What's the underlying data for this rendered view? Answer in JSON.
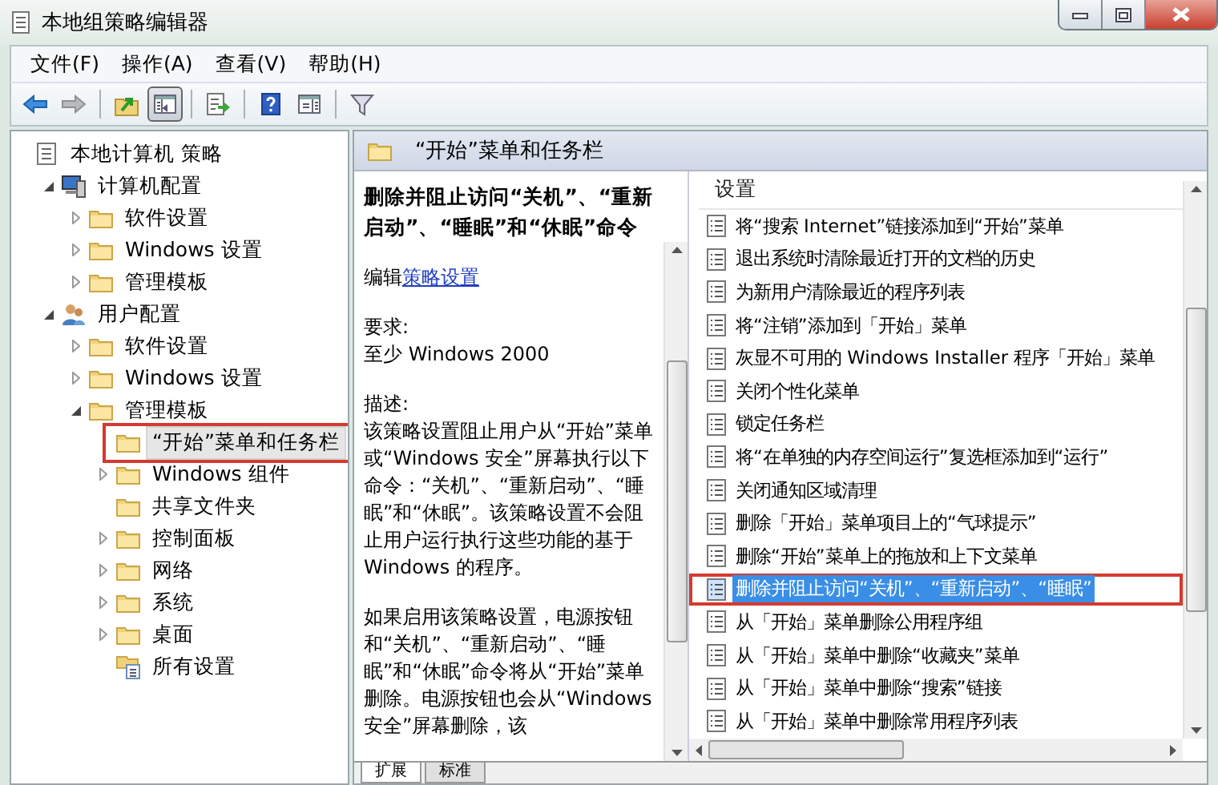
{
  "window": {
    "title": "本地组策略编辑器"
  },
  "menu": [
    {
      "label": "文件(F)"
    },
    {
      "label": "操作(A)"
    },
    {
      "label": "查看(V)"
    },
    {
      "label": "帮助(H)"
    }
  ],
  "toolbar": [
    {
      "kind": "back",
      "disabled": false,
      "pressed": false
    },
    {
      "kind": "forward",
      "disabled": true,
      "pressed": false
    },
    {
      "kind": "separator"
    },
    {
      "kind": "up",
      "disabled": false,
      "pressed": false
    },
    {
      "kind": "tree",
      "disabled": false,
      "pressed": true
    },
    {
      "kind": "separator"
    },
    {
      "kind": "export",
      "disabled": false,
      "pressed": false
    },
    {
      "kind": "separator"
    },
    {
      "kind": "help",
      "disabled": false,
      "pressed": false
    },
    {
      "kind": "pane",
      "disabled": false,
      "pressed": false
    },
    {
      "kind": "separator"
    },
    {
      "kind": "filter",
      "disabled": false,
      "pressed": false
    }
  ],
  "tree": [
    {
      "label": "本地计算机 策略",
      "kind": "policy",
      "selected": false,
      "annotated": false,
      "children": [
        {
          "label": "计算机配置",
          "kind": "computer",
          "expanded": true,
          "selected": false,
          "annotated": false,
          "children": [
            {
              "label": "软件设置",
              "kind": "folder",
              "expanded": false,
              "selected": false,
              "annotated": false
            },
            {
              "label": "Windows 设置",
              "kind": "folder",
              "expanded": false,
              "selected": false,
              "annotated": false
            },
            {
              "label": "管理模板",
              "kind": "folder",
              "expanded": false,
              "selected": false,
              "annotated": false
            }
          ]
        },
        {
          "label": "用户配置",
          "kind": "user",
          "expanded": true,
          "selected": false,
          "annotated": false,
          "children": [
            {
              "label": "软件设置",
              "kind": "folder",
              "expanded": false,
              "selected": false,
              "annotated": false
            },
            {
              "label": "Windows 设置",
              "kind": "folder",
              "expanded": false,
              "selected": false,
              "annotated": false
            },
            {
              "label": "管理模板",
              "kind": "folder",
              "expanded": true,
              "selected": false,
              "annotated": false,
              "children": [
                {
                  "label": "“开始”菜单和任务栏",
                  "kind": "folder",
                  "selected": true,
                  "annotated": true
                },
                {
                  "label": "Windows 组件",
                  "kind": "folder",
                  "expanded": false,
                  "selected": false,
                  "annotated": false
                },
                {
                  "label": "共享文件夹",
                  "kind": "folder",
                  "selected": false,
                  "annotated": false
                },
                {
                  "label": "控制面板",
                  "kind": "folder",
                  "expanded": false,
                  "selected": false,
                  "annotated": false
                },
                {
                  "label": "网络",
                  "kind": "folder",
                  "expanded": false,
                  "selected": false,
                  "annotated": false
                },
                {
                  "label": "系统",
                  "kind": "folder",
                  "expanded": false,
                  "selected": false,
                  "annotated": false
                },
                {
                  "label": "桌面",
                  "kind": "folder",
                  "expanded": false,
                  "selected": false,
                  "annotated": false
                },
                {
                  "label": "所有设置",
                  "kind": "all-settings",
                  "selected": false,
                  "annotated": false
                }
              ]
            }
          ]
        }
      ]
    }
  ],
  "pane": {
    "title": "“开始”菜单和任务栏"
  },
  "description": {
    "title": "删除并阻止访问“关机”、“重新启动”、“睡眠”和“休眠”命令",
    "edit_prefix": "编辑",
    "edit_link": "策略设置",
    "requirements_label": "要求:",
    "requirements": "至少 Windows 2000",
    "description_label": "描述:",
    "paragraphs": [
      "该策略设置阻止用户从“开始”菜单或“Windows 安全”屏幕执行以下命令：“关机”、“重新启动”、“睡眠”和“休眠”。该策略设置不会阻止用户运行执行这些功能的基于 Windows 的程序。",
      "如果启用该策略设置，电源按钮和“关机”、“重新启动”、“睡眠”和“休眠”命令将从“开始”菜单删除。电源按钮也会从“Windows 安全”屏幕删除，该"
    ]
  },
  "list": {
    "column": "设置",
    "rows": [
      {
        "label": "将“搜索 Internet”链接添加到“开始”菜单",
        "selected": false,
        "annotated": false
      },
      {
        "label": "退出系统时清除最近打开的文档的历史",
        "selected": false,
        "annotated": false
      },
      {
        "label": "为新用户清除最近的程序列表",
        "selected": false,
        "annotated": false
      },
      {
        "label": "将“注销”添加到「开始」菜单",
        "selected": false,
        "annotated": false
      },
      {
        "label": "灰显不可用的 Windows Installer 程序「开始」菜单",
        "selected": false,
        "annotated": false
      },
      {
        "label": "关闭个性化菜单",
        "selected": false,
        "annotated": false
      },
      {
        "label": "锁定任务栏",
        "selected": false,
        "annotated": false
      },
      {
        "label": "将“在单独的内存空间运行”复选框添加到“运行”",
        "selected": false,
        "annotated": false
      },
      {
        "label": "关闭通知区域清理",
        "selected": false,
        "annotated": false
      },
      {
        "label": "删除「开始」菜单项目上的“气球提示”",
        "selected": false,
        "annotated": false
      },
      {
        "label": "删除“开始”菜单上的拖放和上下文菜单",
        "selected": false,
        "annotated": false
      },
      {
        "label": "删除并阻止访问“关机”、“重新启动”、“睡眠”",
        "selected": true,
        "annotated": true
      },
      {
        "label": "从「开始」菜单删除公用程序组",
        "selected": false,
        "annotated": false
      },
      {
        "label": "从「开始」菜单中删除“收藏夹”菜单",
        "selected": false,
        "annotated": false
      },
      {
        "label": "从「开始」菜单中删除“搜索”链接",
        "selected": false,
        "annotated": false
      },
      {
        "label": "从「开始」菜单中删除常用程序列表",
        "selected": false,
        "annotated": false
      }
    ]
  },
  "tabs": [
    {
      "label": "扩展",
      "selected": true
    },
    {
      "label": "标准",
      "selected": false
    }
  ]
}
